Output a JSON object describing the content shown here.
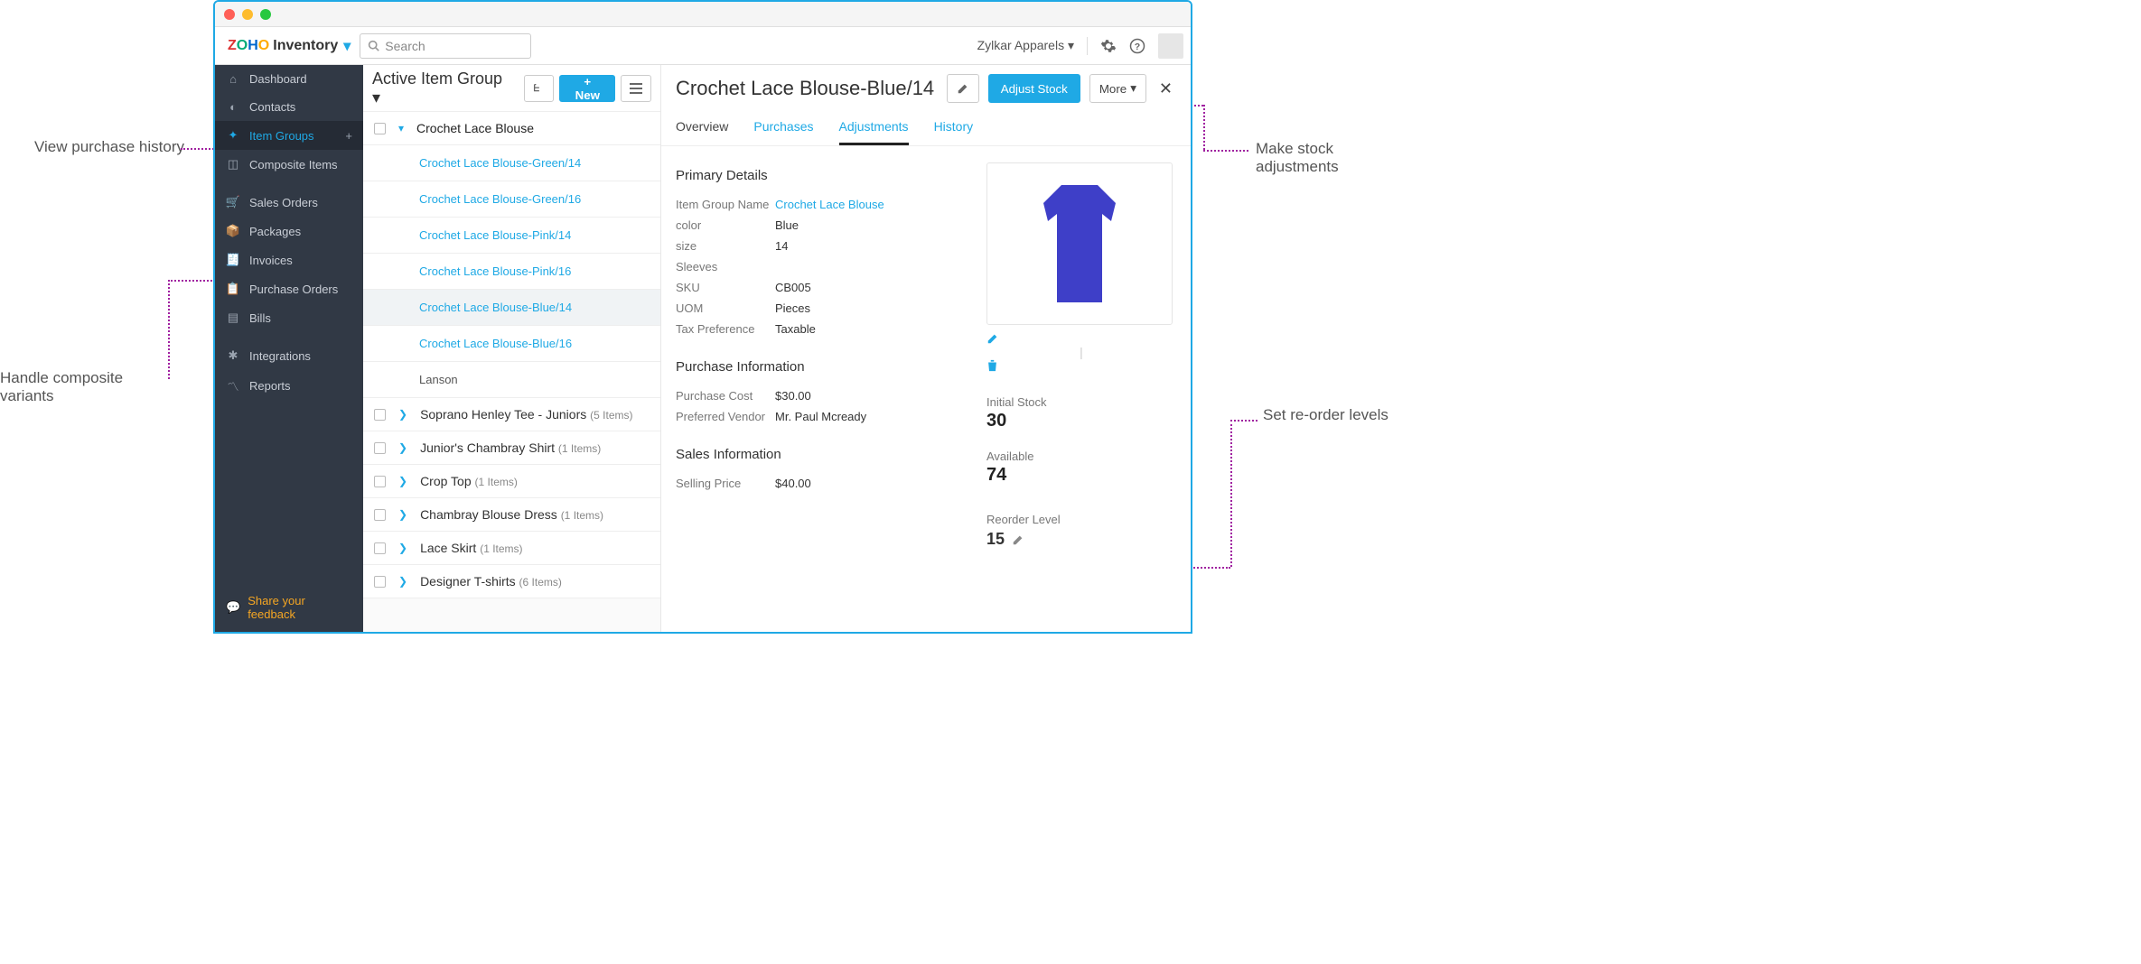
{
  "window": {
    "brand_app": "Inventory",
    "search_placeholder": "Search",
    "org_name": "Zylkar Apparels"
  },
  "sidebar": {
    "items": [
      {
        "label": "Dashboard"
      },
      {
        "label": "Contacts"
      },
      {
        "label": "Item Groups"
      },
      {
        "label": "Composite Items"
      },
      {
        "label": "Sales Orders"
      },
      {
        "label": "Packages"
      },
      {
        "label": "Invoices"
      },
      {
        "label": "Purchase Orders"
      },
      {
        "label": "Bills"
      },
      {
        "label": "Integrations"
      },
      {
        "label": "Reports"
      }
    ],
    "feedback": "Share your feedback"
  },
  "middle": {
    "title": "Active Item Group",
    "new_label": "New",
    "group_name": "Crochet Lace Blouse",
    "variants": [
      "Crochet Lace Blouse-Green/14",
      "Crochet Lace Blouse-Green/16",
      "Crochet Lace Blouse-Pink/14",
      "Crochet Lace Blouse-Pink/16",
      "Crochet Lace Blouse-Blue/14",
      "Crochet Lace Blouse-Blue/16",
      "Lanson"
    ],
    "other_groups": [
      {
        "name": "Soprano Henley Tee - Juniors",
        "count": "(5 Items)"
      },
      {
        "name": "Junior's Chambray Shirt",
        "count": "(1 Items)"
      },
      {
        "name": "Crop Top",
        "count": "(1 Items)"
      },
      {
        "name": "Chambray Blouse Dress",
        "count": "(1 Items)"
      },
      {
        "name": "Lace Skirt",
        "count": "(1 Items)"
      },
      {
        "name": "Designer T-shirts",
        "count": "(6 Items)"
      }
    ]
  },
  "detail": {
    "title": "Crochet Lace Blouse-Blue/14",
    "adjust_label": "Adjust Stock",
    "more_label": "More",
    "tabs": {
      "overview": "Overview",
      "purchases": "Purchases",
      "adjustments": "Adjustments",
      "history": "History"
    },
    "primary_heading": "Primary Details",
    "primary": [
      {
        "k": "Item Group Name",
        "v": "Crochet Lace Blouse",
        "link": true
      },
      {
        "k": "color",
        "v": "Blue"
      },
      {
        "k": "size",
        "v": "14"
      },
      {
        "k": "Sleeves",
        "v": ""
      },
      {
        "k": "SKU",
        "v": "CB005"
      },
      {
        "k": "UOM",
        "v": "Pieces"
      },
      {
        "k": "Tax Preference",
        "v": "Taxable"
      }
    ],
    "purchase_heading": "Purchase Information",
    "purchase": [
      {
        "k": "Purchase Cost",
        "v": "$30.00"
      },
      {
        "k": "Preferred Vendor",
        "v": "Mr. Paul Mcready"
      }
    ],
    "sales_heading": "Sales Information",
    "sales": [
      {
        "k": "Selling Price",
        "v": "$40.00"
      }
    ],
    "stock": {
      "initial_label": "Initial Stock",
      "initial_value": "30",
      "available_label": "Available",
      "available_value": "74",
      "reorder_label": "Reorder Level",
      "reorder_value": "15"
    }
  },
  "annotations": {
    "a1": "View purchase history",
    "a2": "Handle composite variants",
    "a3": "Make stock adjustments",
    "a4": "Set re-order levels"
  }
}
